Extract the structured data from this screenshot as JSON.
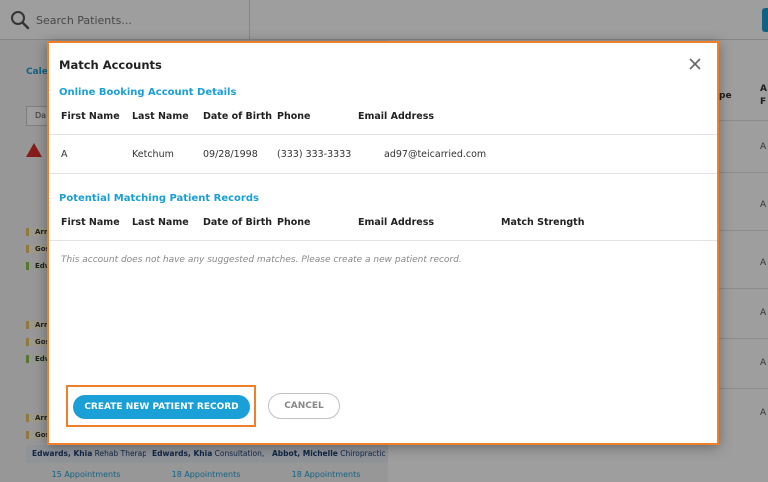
{
  "search": {
    "placeholder": "Search Patients..."
  },
  "background": {
    "calendar_label": "Cale",
    "day_label": "Da",
    "names": [
      "Arm",
      "Gos",
      "Edw",
      "Arm",
      "Gos",
      "Edw",
      "Arm",
      "Gos"
    ],
    "appointments": [
      {
        "name": "Edwards, Khia",
        "type": "Rehab Therap..."
      },
      {
        "name": "Edwards, Khia",
        "type": "Consultation, ..."
      },
      {
        "name": "Abbot, Michelle",
        "type": "Chiropractic..."
      }
    ],
    "counts": [
      "15 Appointments",
      "18 Appointments",
      "18 Appointments"
    ],
    "right_headers": [
      "pe",
      "A",
      "F"
    ],
    "right_cells": [
      "A",
      "A",
      "A",
      "A",
      "A",
      "A"
    ]
  },
  "modal": {
    "title": "Match Accounts",
    "close_icon": "close-icon",
    "booking_section": {
      "title": "Online Booking Account Details",
      "headers": [
        "First Name",
        "Last Name",
        "Date of Birth",
        "Phone",
        "Email Address"
      ],
      "row": {
        "first_name": "A",
        "last_name": "Ketchum",
        "dob": "09/28/1998",
        "phone": "(333) 333-3333",
        "email": "ad97@teicarried.com"
      }
    },
    "matching_section": {
      "title": "Potential Matching Patient Records",
      "headers": [
        "First Name",
        "Last Name",
        "Date of Birth",
        "Phone",
        "Email Address",
        "Match Strength"
      ],
      "empty_message": "This account does not have any suggested matches. Please create a new patient record."
    },
    "buttons": {
      "create": "CREATE NEW PATIENT RECORD",
      "cancel": "CANCEL"
    }
  },
  "colors": {
    "accent": "#1a9fd6",
    "highlight": "#f07f2b"
  }
}
